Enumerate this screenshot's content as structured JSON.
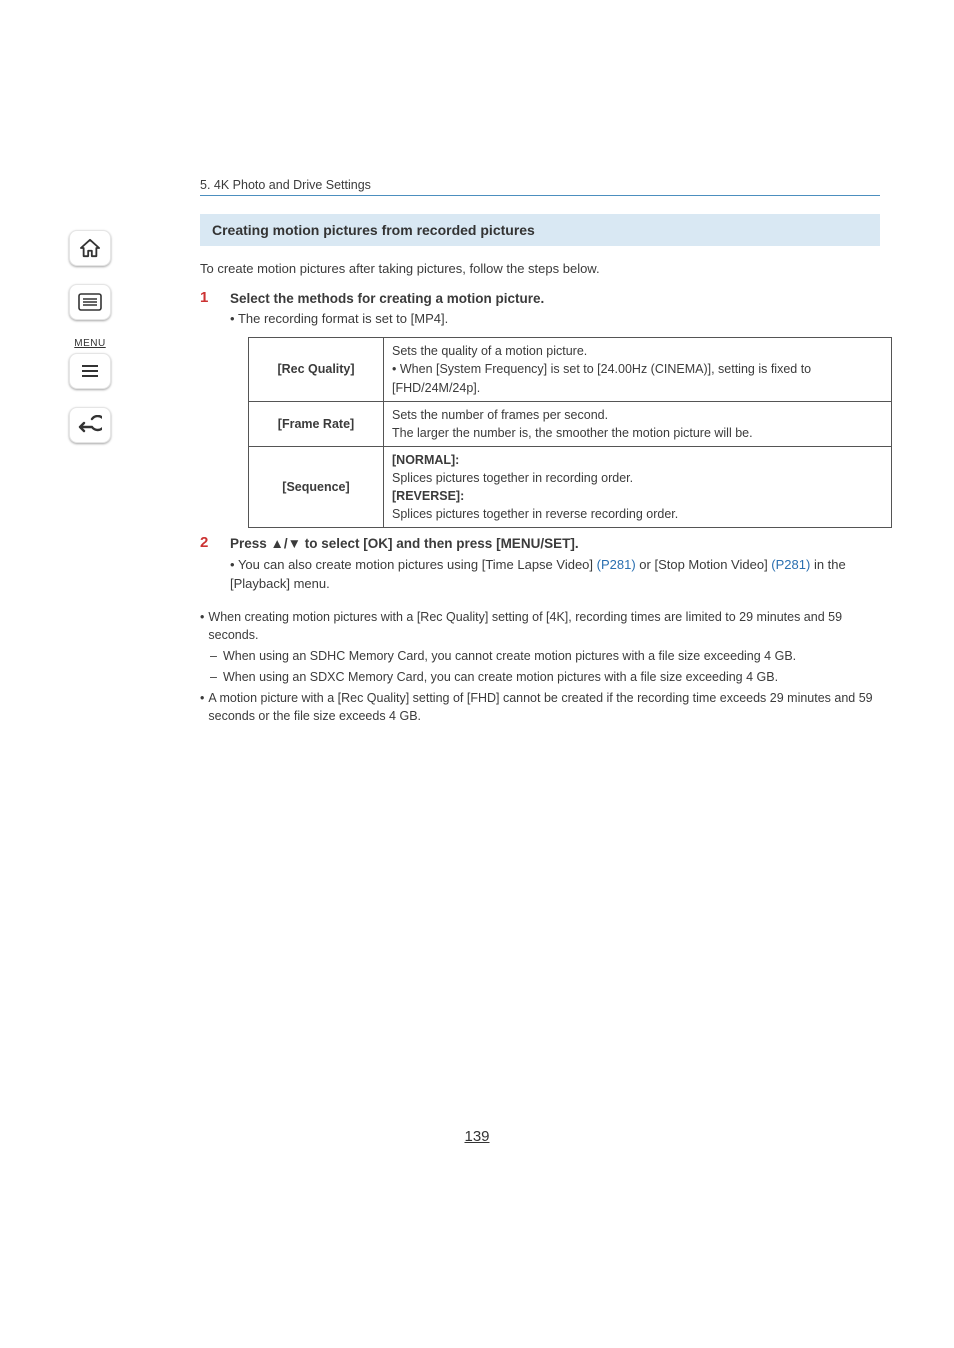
{
  "sidebar": {
    "home_icon": "home-icon",
    "toc_icon": "toc-icon",
    "menu_label": "MENU",
    "back_icon": "back-icon"
  },
  "breadcrumb": "5. 4K Photo and Drive Settings",
  "heading": "Creating motion pictures from recorded pictures",
  "intro": "To create motion pictures after taking pictures, follow the steps below.",
  "steps": [
    {
      "num": "1",
      "title": "Select the methods for creating a motion picture.",
      "sub_bullet": "•",
      "sub": "The recording format is set to [MP4]."
    },
    {
      "num": "2",
      "title_prefix": "Press ",
      "title_arrows": "▲/▼",
      "title_suffix": " to select [OK] and then press [MENU/SET].",
      "sub_bullet": "•",
      "sub_part1": "You can also create motion pictures using [Time Lapse Video] ",
      "sub_link1": "(P281)",
      "sub_part2": " or [Stop Motion Video] ",
      "sub_link2": "(P281)",
      "sub_part3": " in the [Playback] menu."
    }
  ],
  "table": {
    "rows": [
      {
        "label": "[Rec Quality]",
        "line1": "Sets the quality of a motion picture.",
        "bullet": "•",
        "line2a": "When [System Frequency] is set to [24.00Hz (CINEMA)], setting is fixed to [FHD/24M/24p]."
      },
      {
        "label": "[Frame Rate]",
        "line1": "Sets the number of frames per second.",
        "line2": "The larger the number is, the smoother the motion picture will be."
      },
      {
        "label": "[Sequence]",
        "h1": "[NORMAL]:",
        "d1": "Splices pictures together in recording order.",
        "h2": "[REVERSE]:",
        "d2": "Splices pictures together in reverse recording order."
      }
    ]
  },
  "notes": {
    "n1_bullet": "•",
    "n1": "When creating motion pictures with a [Rec Quality] setting of [4K], recording times are limited to 29 minutes and 59 seconds.",
    "n1a_dash": "–",
    "n1a": "When using an SDHC Memory Card, you cannot create motion pictures with a file size exceeding 4 GB.",
    "n1b_dash": "–",
    "n1b": "When using an SDXC Memory Card, you can create motion pictures with a file size exceeding 4 GB.",
    "n2_bullet": "•",
    "n2": "A motion picture with a [Rec Quality] setting of [FHD] cannot be created if the recording time exceeds 29 minutes and 59 seconds or the file size exceeds 4 GB."
  },
  "page_number": "139"
}
